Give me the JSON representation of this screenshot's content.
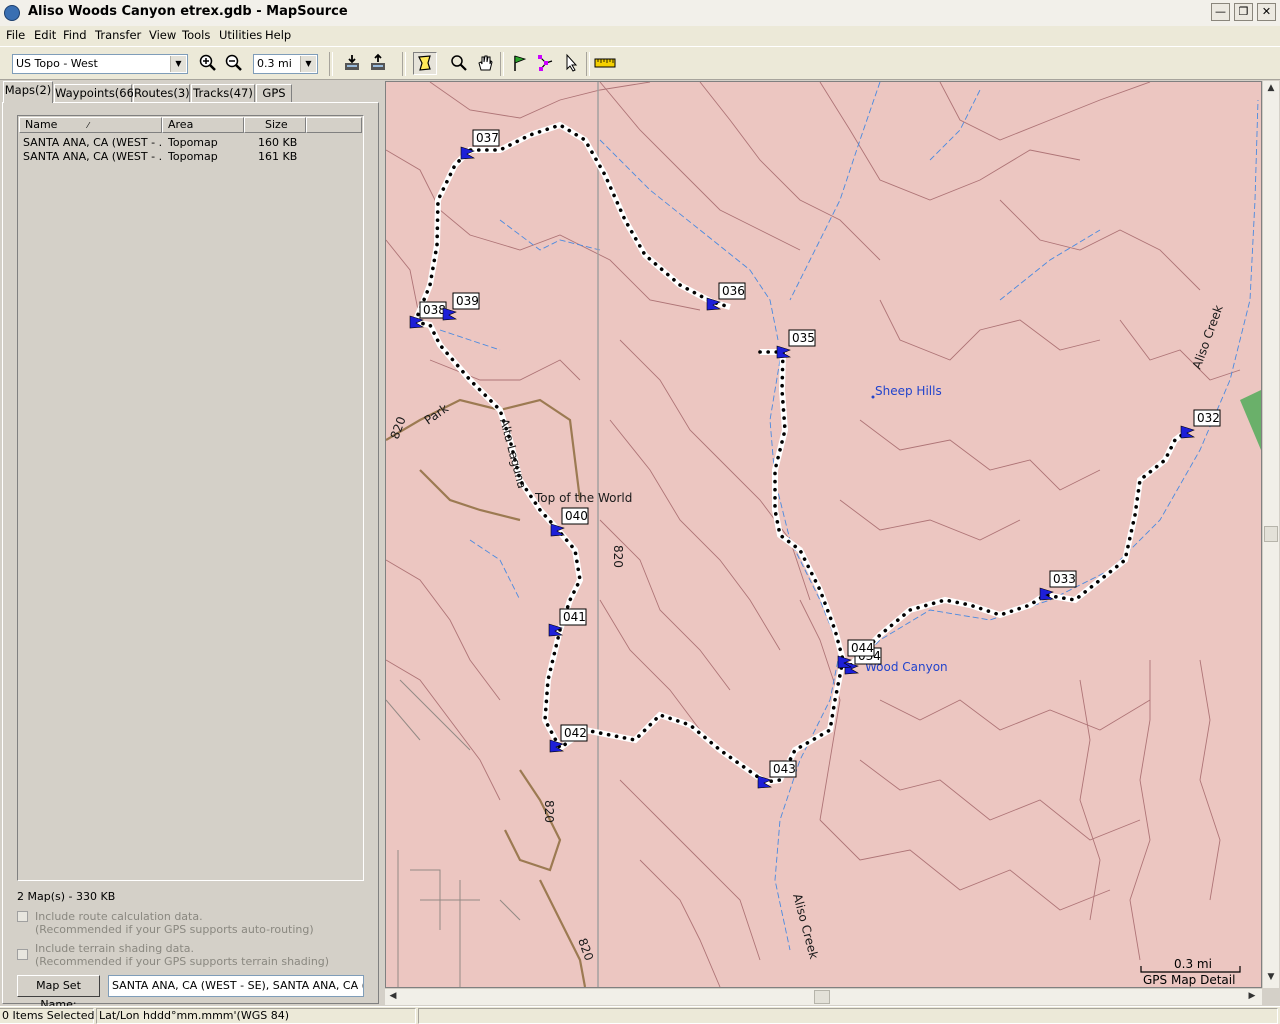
{
  "window": {
    "title": "Aliso Woods Canyon etrex.gdb - MapSource"
  },
  "menu": [
    "File",
    "Edit",
    "Find",
    "Transfer",
    "View",
    "Tools",
    "Utilities",
    "Help"
  ],
  "toolbar": {
    "product": "US Topo - West",
    "zoom_scale": "0.3 mi"
  },
  "tabs": [
    "Maps(2)",
    "Waypoints(66)",
    "Routes(3)",
    "Tracks(47)",
    "GPS"
  ],
  "maps_list": {
    "columns": [
      "Name",
      "Area",
      "Size"
    ],
    "rows": [
      {
        "name": "SANTA ANA, CA (WEST - ...",
        "area": "Topomap",
        "size": "160 KB"
      },
      {
        "name": "SANTA ANA, CA (WEST - ...",
        "area": "Topomap",
        "size": "161 KB"
      }
    ]
  },
  "summary": "2 Map(s) - 330 KB",
  "options": {
    "route_line1": "Include route calculation data.",
    "route_line2": "(Recommended if your GPS supports auto-routing)",
    "terrain_line1": "Include terrain shading data.",
    "terrain_line2": "(Recommended if your GPS supports terrain shading)"
  },
  "mapset": {
    "button_label": "Map Set Name:",
    "value": "SANTA ANA, CA (WEST - SE), SANTA ANA, CA (WE"
  },
  "map": {
    "colors": {
      "land": "#ecc6c1",
      "contour": "#a4666a",
      "water": "#4a8ae0",
      "road": "#9c7a52"
    },
    "waypoints": [
      "032",
      "033",
      "035",
      "036",
      "037",
      "038",
      "039",
      "040",
      "041",
      "042",
      "043",
      "044",
      "034"
    ],
    "labels": {
      "sheep_hills": "Sheep Hills",
      "top_of_world": "Top of the World",
      "wood_canyon": "Wood Canyon",
      "aliso_creek_n": "Aliso Creek",
      "aliso_creek_s": "Aliso Creek",
      "park": "Park",
      "laguna": "Alta Laguna",
      "r820_a": "820",
      "r820_b": "820",
      "r820_c": "820",
      "r820_d": "820"
    },
    "scale_label": "0.3 mi",
    "detail_label": "GPS Map Detail"
  },
  "status": {
    "selected": "0 Items Selected",
    "coords": "Lat/Lon hddd°mm.mmm'(WGS 84)"
  }
}
